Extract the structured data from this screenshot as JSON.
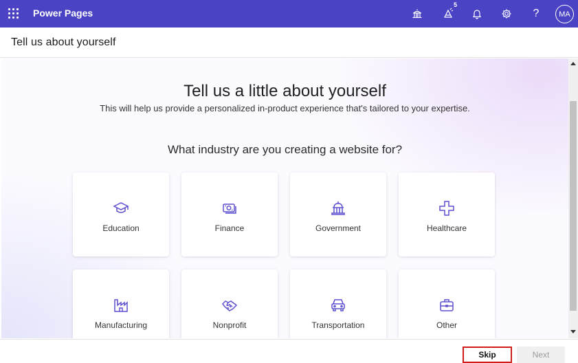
{
  "topbar": {
    "app_name": "Power Pages",
    "notification_badge": "5",
    "avatar_initials": "MA",
    "help_label": "?",
    "background_color": "#4a44c4"
  },
  "page_header": {
    "title": "Tell us about yourself"
  },
  "main": {
    "title": "Tell us a little about yourself",
    "subtitle": "This will help us provide a personalized in-product experience that's tailored to your expertise.",
    "question": "What industry are you creating a website for?",
    "industries": [
      {
        "label": "Education",
        "icon": "graduation-cap-icon"
      },
      {
        "label": "Finance",
        "icon": "money-icon"
      },
      {
        "label": "Government",
        "icon": "government-building-icon"
      },
      {
        "label": "Healthcare",
        "icon": "medical-cross-icon"
      },
      {
        "label": "Manufacturing",
        "icon": "factory-icon"
      },
      {
        "label": "Nonprofit",
        "icon": "handshake-icon"
      },
      {
        "label": "Transportation",
        "icon": "vehicle-icon"
      },
      {
        "label": "Other",
        "icon": "briefcase-icon"
      }
    ],
    "icon_color": "#5b4fcf"
  },
  "footer": {
    "skip_label": "Skip",
    "next_label": "Next"
  }
}
